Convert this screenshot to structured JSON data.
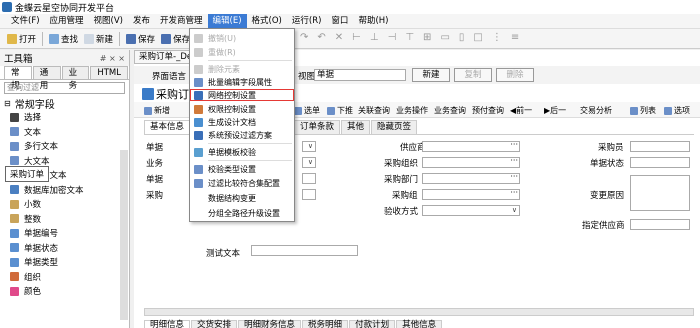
{
  "app": {
    "title": "金蝶云星空协同开发平台"
  },
  "menubar": [
    "文件(F)",
    "应用管理",
    "视图(V)",
    "发布",
    "开发商管理",
    "编辑(E)",
    "格式(O)",
    "运行(R)",
    "窗口",
    "帮助(H)"
  ],
  "toolbar": {
    "open": "打开",
    "find": "查找",
    "new": "新建",
    "save": "保存",
    "save_all": "保存全部"
  },
  "toolbox": {
    "title": "工具箱",
    "pins": "# × ×",
    "tabs": [
      "常规",
      "通用",
      "业务",
      "HTML"
    ],
    "filter_placeholder": "查询过滤",
    "section": "常规字段",
    "items": [
      "选择",
      "文本",
      "多行文本",
      "大文本",
      "多语言文本",
      "数据库加密文本",
      "小数",
      "整数",
      "单据编号",
      "单据状态",
      "单据类型",
      "组织",
      "颜色"
    ],
    "tooltip": "采购订单"
  },
  "doc": {
    "tab": "采购订单-_Def...",
    "view_prefix": "界面语言",
    "view_label": "视图",
    "view_value": "单据",
    "new_btn": "新建",
    "copy_btn": "复制",
    "delete_btn": "删除",
    "form_title": "采购订...",
    "formbar": [
      "新增",
      "选单",
      "下推",
      "关联查询",
      "业务操作",
      "业务查询",
      "预付查询",
      "前一",
      "后一",
      "交易分析",
      "列表",
      "选项"
    ],
    "form_tabs": [
      "基本信息",
      "订单条款",
      "其他",
      "隐藏页签"
    ],
    "left_labels": [
      "单据",
      "业务",
      "单据",
      "采购"
    ],
    "mid_labels": [
      "供应商",
      "采购组织",
      "采购部门",
      "采购组",
      "验收方式"
    ],
    "right_labels": [
      "采购员",
      "单据状态",
      "变更原因",
      "指定供应商"
    ],
    "test_label": "测试文本",
    "bottom_tabs": [
      "明细信息",
      "交货安排",
      "明细财务信息",
      "税务明细",
      "付款计划",
      "其他信息"
    ]
  },
  "edit_menu": {
    "items": [
      {
        "label": "撤销(U)",
        "icon": "undo-icon",
        "enabled": false
      },
      {
        "label": "重做(R)",
        "icon": "redo-icon",
        "enabled": false
      },
      {
        "label": "删除元素",
        "icon": "delete-element-icon",
        "enabled": false
      },
      {
        "label": "批量编辑字段属性",
        "icon": "batch-edit-icon",
        "enabled": true
      },
      {
        "label": "网络控制设置",
        "icon": "network-control-icon",
        "enabled": true,
        "highlighted": true
      },
      {
        "label": "权限控制设置",
        "icon": "permission-icon",
        "enabled": true
      },
      {
        "label": "生成设计文档",
        "icon": "document-icon",
        "enabled": true
      },
      {
        "label": "系统预设过滤方案",
        "icon": "filter-icon",
        "enabled": true
      },
      {
        "label": "单据模板校验",
        "icon": "template-check-icon",
        "enabled": true
      },
      {
        "label": "校验类型设置",
        "icon": "check-type-icon",
        "enabled": true
      },
      {
        "label": "过滤比较符合集配置",
        "icon": "compare-icon",
        "enabled": true
      },
      {
        "label": "数据结构变更",
        "icon": "data-structure-icon",
        "enabled": true
      },
      {
        "label": "分组全路径升级设置",
        "icon": "group-path-icon",
        "enabled": true
      }
    ]
  },
  "colors": {
    "accent": "#3b7bd4",
    "highlight_border": "#e53935"
  }
}
